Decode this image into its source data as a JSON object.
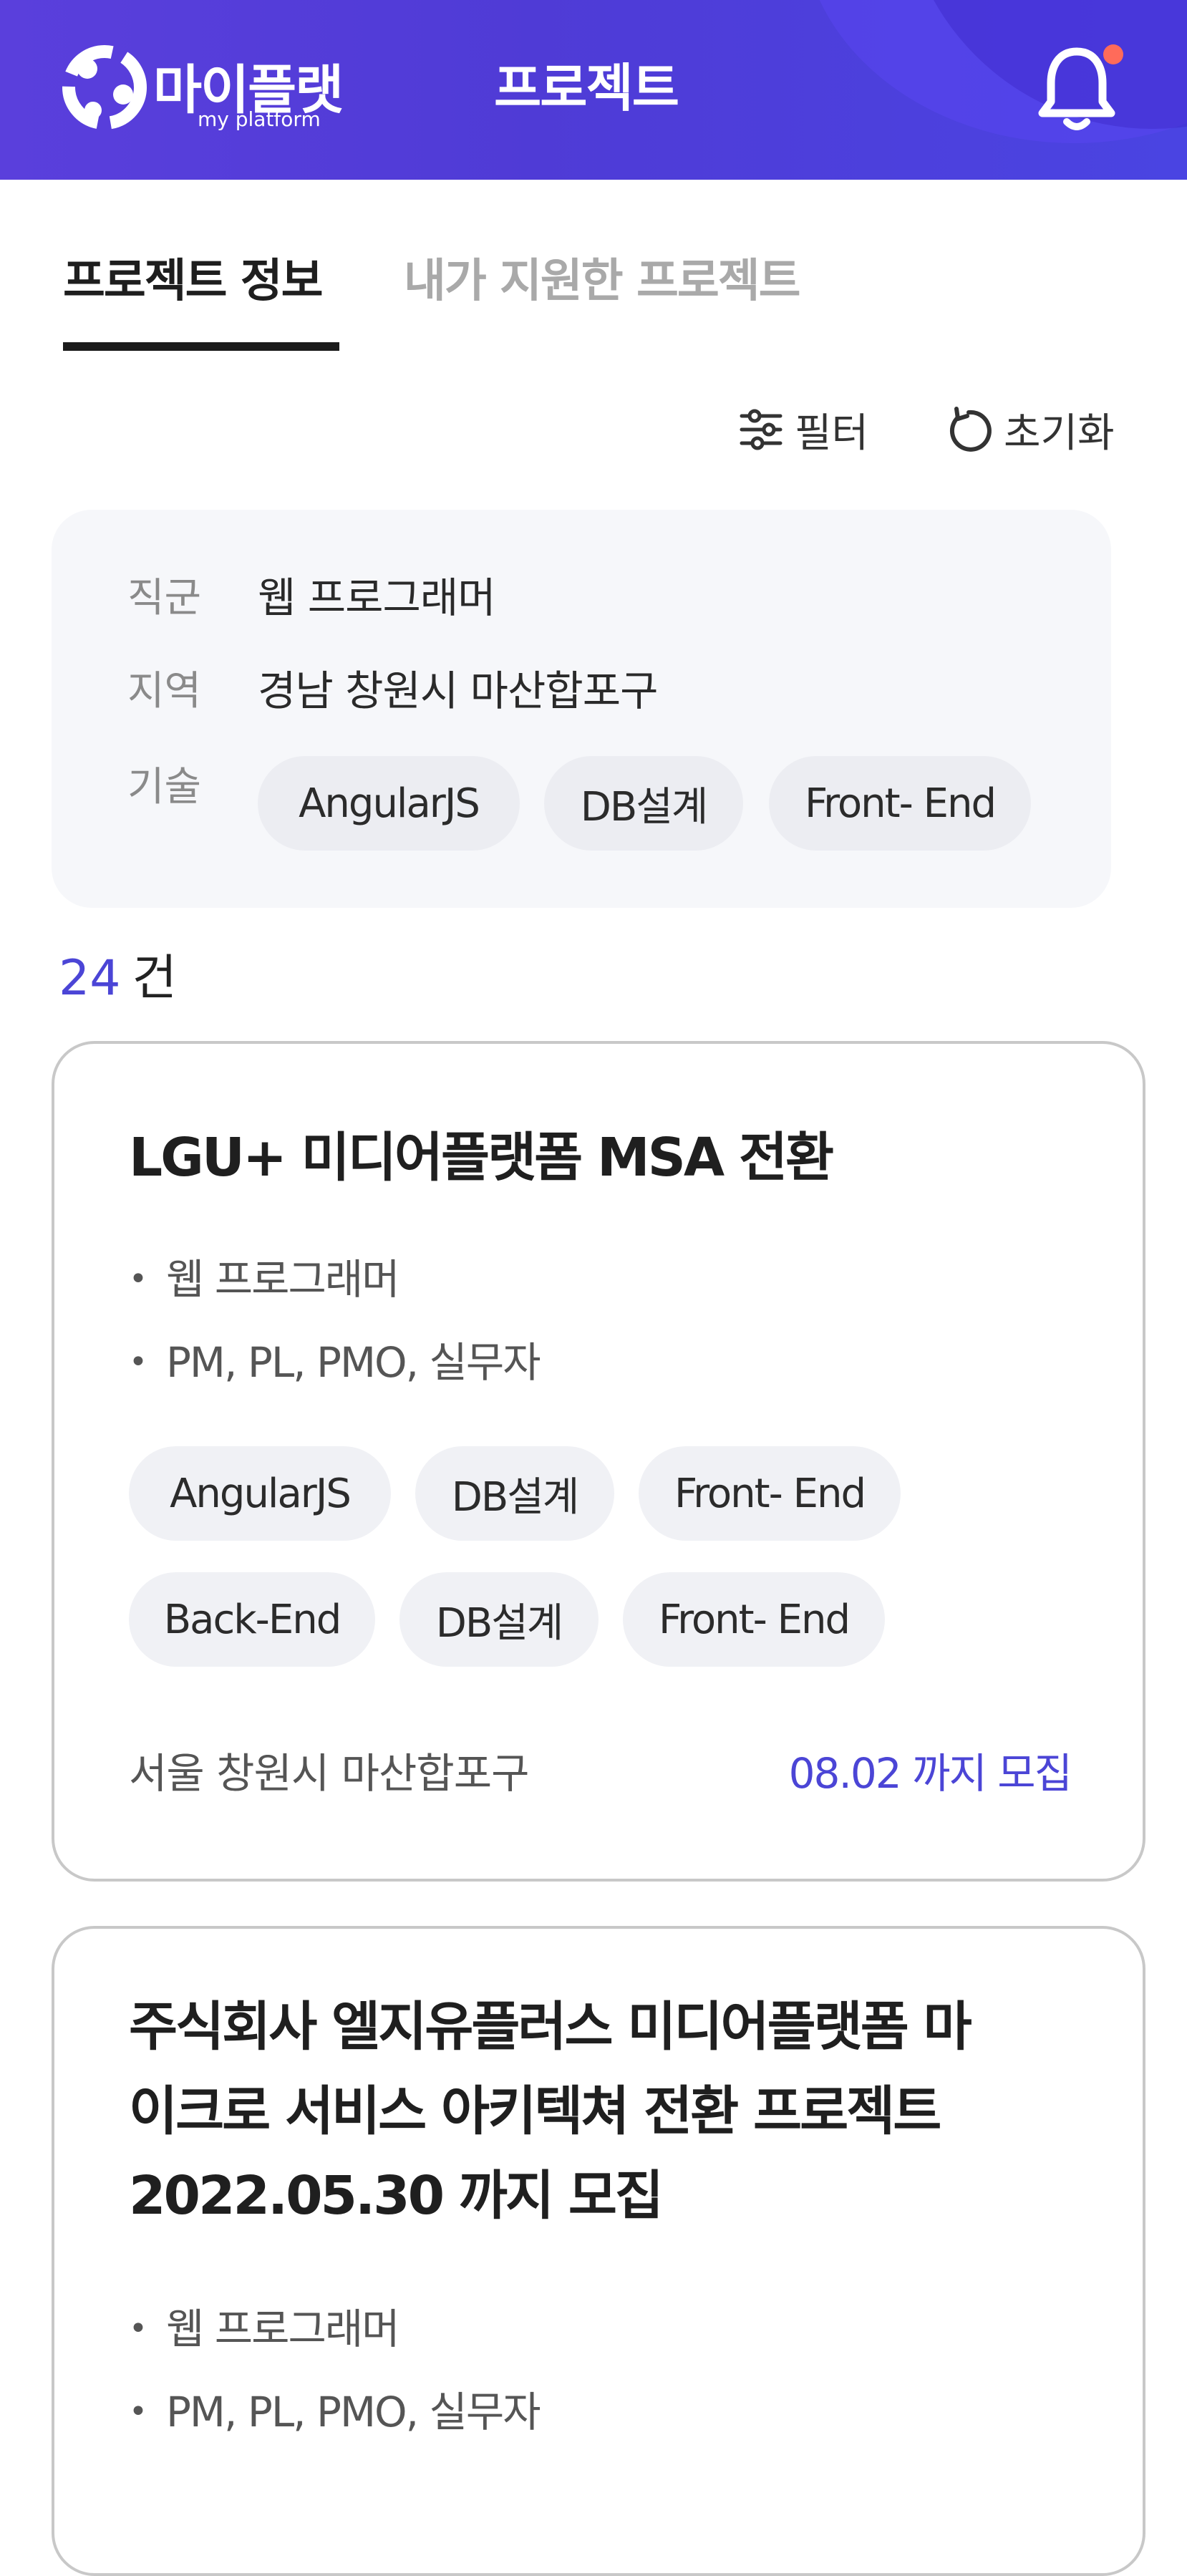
{
  "header": {
    "logo_text": "마이플랫",
    "logo_sub": "my platform",
    "title": "프로젝트",
    "bell_icon": "bell-icon",
    "notification_dot_color": "#ff6b5a",
    "brand_color": "#4f3bd6"
  },
  "tabs": [
    {
      "label": "프로젝트 정보",
      "active": true
    },
    {
      "label": "내가 지원한 프로젝트",
      "active": false
    }
  ],
  "tools": {
    "filter_label": "필터",
    "filter_icon": "sliders-icon",
    "reset_label": "초기화",
    "reset_icon": "refresh-icon"
  },
  "condition": {
    "job_label": "직군",
    "job_value": "웹 프로그래머",
    "region_label": "지역",
    "region_value": "경남 창원시 마산합포구",
    "skill_label": "기술",
    "skills": [
      "AngularJS",
      "DB설계",
      "Front- End"
    ]
  },
  "count": {
    "number": "24",
    "unit": "건"
  },
  "projects": [
    {
      "title_lines": [
        "LGU+ 미디어플랫폼 MSA 전환"
      ],
      "bullets": [
        "웹 프로그래머",
        "PM, PL, PMO, 실무자"
      ],
      "skills": [
        "AngularJS",
        "DB설계",
        "Front- End",
        "Back-End",
        "DB설계",
        "Front- End"
      ],
      "location": "서울 창원시 마산합포구",
      "deadline": "08.02 까지 모집"
    },
    {
      "title_lines": [
        "주식회사 엘지유플러스 미디어플랫폼 마",
        "이크로 서비스 아키텍쳐 전환 프로젝트",
        "2022.05.30 까지 모집"
      ],
      "bullets": [
        "웹 프로그래머",
        "PM, PL, PMO, 실무자"
      ]
    }
  ]
}
